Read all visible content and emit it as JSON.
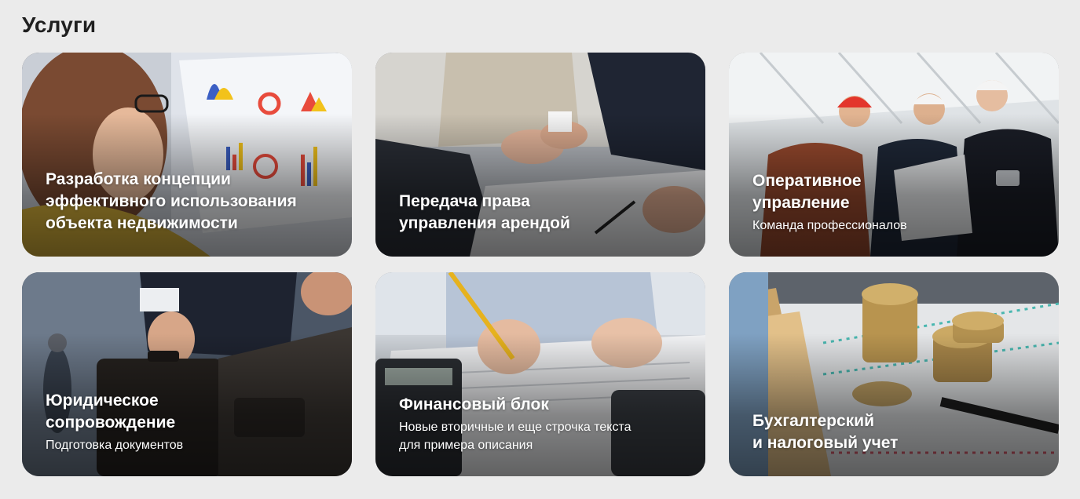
{
  "header": {
    "title": "Услуги"
  },
  "cards": [
    {
      "title": "Разработка концепции\nэффективного использования\nобъекта недвижимости",
      "description": "",
      "image": "presentation-charts-image"
    },
    {
      "title": "Передача права\nуправления арендой",
      "description": "",
      "image": "handshake-image"
    },
    {
      "title": "Оперативное\nуправление",
      "description": "Команда профессионалов",
      "image": "engineers-image"
    },
    {
      "title": "Юридическое\nсопровождение",
      "description": "Подготовка документов",
      "image": "briefcase-image"
    },
    {
      "title": "Финансовый блок",
      "description": "Новые вторичные и еще строчка текста\nдля примера описания",
      "image": "calculator-pencil-image"
    },
    {
      "title": "Бухгалтерский\nи налоговый учет",
      "description": "",
      "image": "coins-banknotes-image"
    }
  ]
}
